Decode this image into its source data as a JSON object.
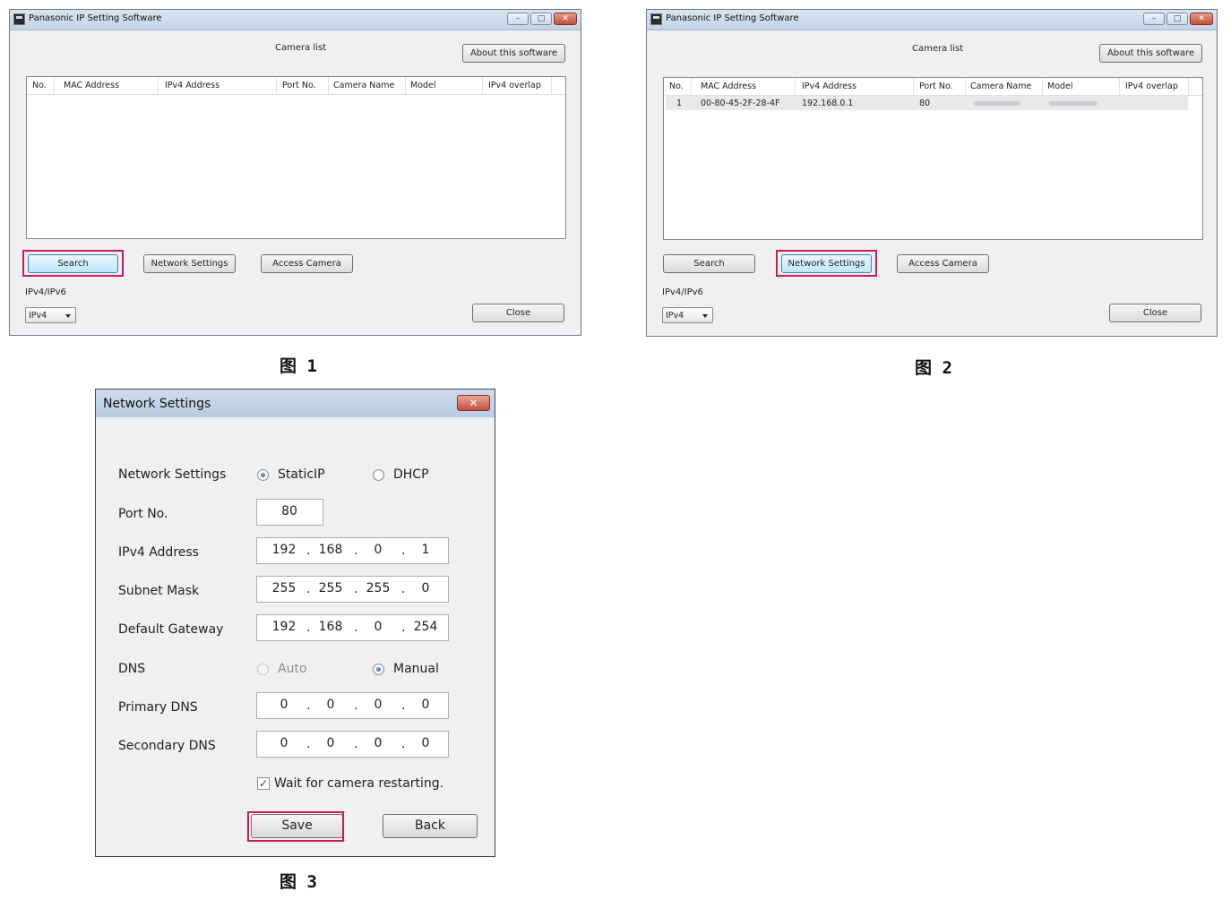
{
  "window": {
    "title": "Panasonic IP Setting Software",
    "camera_list_label": "Camera list",
    "about_button": "About this software",
    "columns": [
      "No.",
      "MAC Address",
      "IPv4 Address",
      "Port No.",
      "Camera Name",
      "Model",
      "IPv4 overlap"
    ],
    "search_button": "Search",
    "network_settings_button": "Network Settings",
    "access_camera_button": "Access Camera",
    "ip_version_label": "IPv4/IPv6",
    "ip_version_value": "IPv4",
    "close_button": "Close",
    "controls": {
      "minimize": "–",
      "maximize": "□",
      "close": "✕"
    }
  },
  "fig2_row": {
    "no": "1",
    "mac": "00-80-45-2F-28-4F",
    "ipv4": "192.168.0.1",
    "port": "80"
  },
  "captions": {
    "fig1": "图 1",
    "fig2": "图 2",
    "fig3": "图 3"
  },
  "dialog": {
    "title": "Network Settings",
    "close_glyph": "✕",
    "network_settings_label": "Network Settings",
    "static_ip": "StaticIP",
    "dhcp": "DHCP",
    "port_label": "Port No.",
    "port_value": "80",
    "ipv4_label": "IPv4 Address",
    "ipv4": [
      "192",
      "168",
      "0",
      "1"
    ],
    "subnet_label": "Subnet Mask",
    "subnet": [
      "255",
      "255",
      "255",
      "0"
    ],
    "gateway_label": "Default Gateway",
    "gateway": [
      "192",
      "168",
      "0",
      "254"
    ],
    "dns_label": "DNS",
    "dns_auto": "Auto",
    "dns_manual": "Manual",
    "primary_dns_label": "Primary DNS",
    "primary_dns": [
      "0",
      "0",
      "0",
      "0"
    ],
    "secondary_dns_label": "Secondary DNS",
    "secondary_dns": [
      "0",
      "0",
      "0",
      "0"
    ],
    "wait_checkbox": "Wait for camera restarting.",
    "check_glyph": "✓",
    "save_button": "Save",
    "back_button": "Back",
    "ip_separator": "."
  }
}
